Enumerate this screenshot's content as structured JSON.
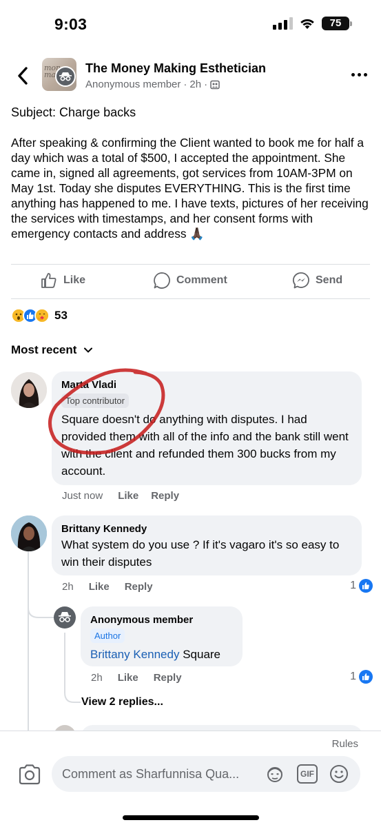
{
  "status_bar": {
    "time": "9:03",
    "battery": "75"
  },
  "header": {
    "group_name": "The Money Making Esthetician",
    "author": "Anonymous member",
    "time": "2h",
    "avatar_text": "mon\nmaki"
  },
  "post": {
    "subject": "Subject: Charge backs",
    "body": "After speaking & confirming the Client wanted to book me for half a day which was a total of $500, I accepted the appointment. She came in, signed all agreements, got services from 10AM-3PM on May 1st. Today she disputes EVERYTHING. This is the first time anything has happened to me. I have texts, pictures of her receiving the services with timestamps, and her consent forms with emergency contacts and address 🙏🏿"
  },
  "actions": {
    "like": "Like",
    "comment": "Comment",
    "send": "Send"
  },
  "reactions": {
    "count": "53"
  },
  "sort": {
    "label": "Most recent"
  },
  "comments": [
    {
      "name": "Marta Vladi",
      "badge": "Top contributor",
      "text": "Square doesn't do anything with disputes. I had provided them with all of the info and the bank still went with the client and refunded them 300 bucks from my account.",
      "time": "Just now",
      "like": "Like",
      "reply": "Reply"
    },
    {
      "name": "Brittany Kennedy",
      "text": "What system do you use ? If it's vagaro it's so easy to win their disputes",
      "time": "2h",
      "like": "Like",
      "reply": "Reply",
      "likes": "1"
    },
    {
      "name": "Anonymous member",
      "badge": "Author",
      "mention": "Brittany Kennedy",
      "text": " Square",
      "time": "2h",
      "like": "Like",
      "reply": "Reply",
      "likes": "1"
    }
  ],
  "view_replies": "View 2 replies...",
  "composer": {
    "rules": "Rules",
    "placeholder": "Comment as Sharfunnisa Qua...",
    "gif": "GIF"
  }
}
